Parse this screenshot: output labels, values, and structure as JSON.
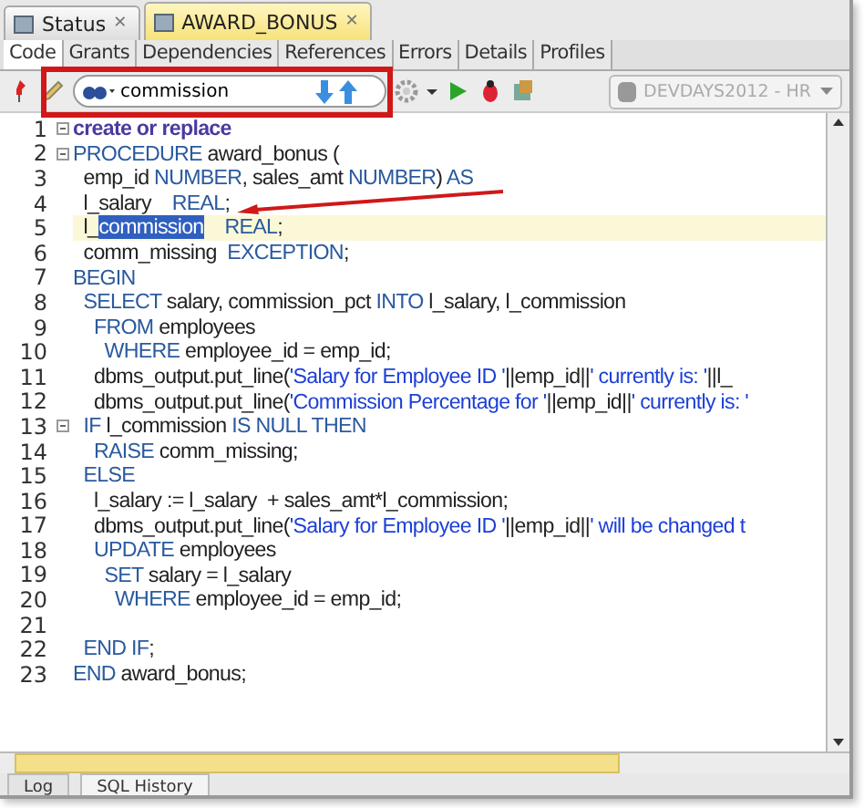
{
  "tabs": [
    {
      "label": "Status",
      "close": "✕",
      "selected": false
    },
    {
      "label": "AWARD_BONUS",
      "close": "✕",
      "selected": true
    }
  ],
  "subtabs": [
    {
      "label": "Code",
      "selected": true
    },
    {
      "label": "Grants",
      "selected": false
    },
    {
      "label": "Dependencies",
      "selected": false
    },
    {
      "label": "References",
      "selected": false
    },
    {
      "label": "Errors",
      "selected": false
    },
    {
      "label": "Details",
      "selected": false
    },
    {
      "label": "Profiles",
      "selected": false
    }
  ],
  "search": {
    "value": "commission"
  },
  "connection": {
    "value": "DEVDAYS2012 - HR"
  },
  "code": [
    {
      "number": "1",
      "fold": true,
      "current": false,
      "tokens": [
        {
          "kind": "head",
          "text": "create or replace"
        }
      ]
    },
    {
      "number": "2",
      "fold": true,
      "current": false,
      "tokens": [
        {
          "kind": "kw",
          "text": "PROCEDURE"
        },
        {
          "kind": "plain",
          "text": " award_bonus ("
        }
      ]
    },
    {
      "number": "3",
      "fold": false,
      "current": false,
      "tokens": [
        {
          "kind": "plain",
          "text": "  emp_id "
        },
        {
          "kind": "kw",
          "text": "NUMBER"
        },
        {
          "kind": "plain",
          "text": ", sales_amt "
        },
        {
          "kind": "kw",
          "text": "NUMBER"
        },
        {
          "kind": "plain",
          "text": ") "
        },
        {
          "kind": "kw",
          "text": "AS"
        }
      ]
    },
    {
      "number": "4",
      "fold": false,
      "current": false,
      "tokens": [
        {
          "kind": "plain",
          "text": "  l_salary    "
        },
        {
          "kind": "kw",
          "text": "REAL"
        },
        {
          "kind": "plain",
          "text": ";"
        }
      ]
    },
    {
      "number": "5",
      "fold": false,
      "current": true,
      "tokens": [
        {
          "kind": "plain",
          "text": "  l_"
        },
        {
          "kind": "sel",
          "text": "commission"
        },
        {
          "kind": "kw",
          "text": "    REAL"
        },
        {
          "kind": "plain",
          "text": ";"
        }
      ]
    },
    {
      "number": "6",
      "fold": false,
      "current": false,
      "tokens": [
        {
          "kind": "plain",
          "text": "  comm_missing  "
        },
        {
          "kind": "kw",
          "text": "EXCEPTION"
        },
        {
          "kind": "plain",
          "text": ";"
        }
      ]
    },
    {
      "number": "7",
      "fold": false,
      "current": false,
      "tokens": [
        {
          "kind": "kw",
          "text": "BEGIN"
        }
      ]
    },
    {
      "number": "8",
      "fold": false,
      "current": false,
      "tokens": [
        {
          "kind": "kw",
          "text": "  SELECT"
        },
        {
          "kind": "plain",
          "text": " salary, commission_pct "
        },
        {
          "kind": "kw",
          "text": "INTO"
        },
        {
          "kind": "plain",
          "text": " l_salary, l_commission"
        }
      ]
    },
    {
      "number": "9",
      "fold": false,
      "current": false,
      "tokens": [
        {
          "kind": "kw",
          "text": "    FROM"
        },
        {
          "kind": "plain",
          "text": " employees"
        }
      ]
    },
    {
      "number": "10",
      "fold": false,
      "current": false,
      "tokens": [
        {
          "kind": "kw",
          "text": "      WHERE"
        },
        {
          "kind": "plain",
          "text": " employee_id = emp_id;"
        }
      ]
    },
    {
      "number": "11",
      "fold": false,
      "current": false,
      "tokens": [
        {
          "kind": "plain",
          "text": "    dbms_output.put_line("
        },
        {
          "kind": "str",
          "text": "'Salary for Employee ID '"
        },
        {
          "kind": "plain",
          "text": "||emp_id||"
        },
        {
          "kind": "str",
          "text": "' currently is: '"
        },
        {
          "kind": "plain",
          "text": "||l_"
        }
      ]
    },
    {
      "number": "12",
      "fold": false,
      "current": false,
      "tokens": [
        {
          "kind": "plain",
          "text": "    dbms_output.put_line("
        },
        {
          "kind": "str",
          "text": "'Commission Percentage for '"
        },
        {
          "kind": "plain",
          "text": "||emp_id||"
        },
        {
          "kind": "str",
          "text": "' currently is: '"
        }
      ]
    },
    {
      "number": "13",
      "fold": true,
      "current": false,
      "tokens": [
        {
          "kind": "kw",
          "text": "  IF"
        },
        {
          "kind": "plain",
          "text": " l_commission "
        },
        {
          "kind": "kw",
          "text": "IS NULL THEN"
        }
      ]
    },
    {
      "number": "14",
      "fold": false,
      "current": false,
      "tokens": [
        {
          "kind": "kw",
          "text": "    RAISE"
        },
        {
          "kind": "plain",
          "text": " comm_missing;"
        }
      ]
    },
    {
      "number": "15",
      "fold": false,
      "current": false,
      "tokens": [
        {
          "kind": "kw",
          "text": "  ELSE"
        }
      ]
    },
    {
      "number": "16",
      "fold": false,
      "current": false,
      "tokens": [
        {
          "kind": "plain",
          "text": "    l_salary := l_salary  + sales_amt*l_commission;"
        }
      ]
    },
    {
      "number": "17",
      "fold": false,
      "current": false,
      "tokens": [
        {
          "kind": "plain",
          "text": "    dbms_output.put_line("
        },
        {
          "kind": "str",
          "text": "'Salary for Employee ID '"
        },
        {
          "kind": "plain",
          "text": "||emp_id||"
        },
        {
          "kind": "str",
          "text": "' will be changed t"
        }
      ]
    },
    {
      "number": "18",
      "fold": false,
      "current": false,
      "tokens": [
        {
          "kind": "kw",
          "text": "    UPDATE"
        },
        {
          "kind": "plain",
          "text": " employees"
        }
      ]
    },
    {
      "number": "19",
      "fold": false,
      "current": false,
      "tokens": [
        {
          "kind": "kw",
          "text": "      SET"
        },
        {
          "kind": "plain",
          "text": " salary = l_salary"
        }
      ]
    },
    {
      "number": "20",
      "fold": false,
      "current": false,
      "tokens": [
        {
          "kind": "kw",
          "text": "        WHERE"
        },
        {
          "kind": "plain",
          "text": " employee_id = emp_id;"
        }
      ]
    },
    {
      "number": "21",
      "fold": false,
      "current": false
    },
    {
      "number": "22",
      "fold": false,
      "current": false,
      "tokens": [
        {
          "kind": "kw",
          "text": "  END IF"
        },
        {
          "kind": "plain",
          "text": ";"
        }
      ]
    },
    {
      "number": "23",
      "fold": false,
      "current": false,
      "tokens": [
        {
          "kind": "kw",
          "text": "END"
        },
        {
          "kind": "plain",
          "text": " award_bonus;"
        }
      ]
    }
  ],
  "bottom_tabs": [
    {
      "label": "Log",
      "selected": false
    },
    {
      "label": "SQL History",
      "selected": true
    }
  ]
}
